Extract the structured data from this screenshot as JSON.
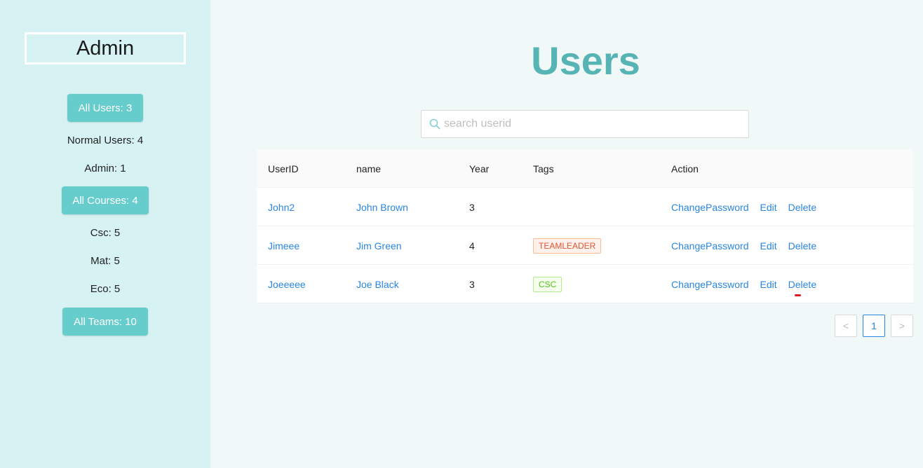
{
  "sidebar": {
    "title": "Admin",
    "all_users": "All Users: 3",
    "normal_users": "Normal Users: 4",
    "admin_count": "Admin: 1",
    "all_courses": "All Courses: 4",
    "csc": "Csc: 5",
    "mat": "Mat: 5",
    "eco": "Eco: 5",
    "all_teams": "All Teams: 10"
  },
  "main": {
    "title": "Users",
    "search_placeholder": "search userid"
  },
  "table": {
    "headers": [
      "UserID",
      "name",
      "Year",
      "Tags",
      "Action"
    ],
    "actions": [
      "ChangePassword",
      "Edit",
      "Delete"
    ],
    "rows": [
      {
        "userid": "John2",
        "name": "John Brown",
        "year": "3",
        "tag": ""
      },
      {
        "userid": "Jimeee",
        "name": "Jim Green",
        "year": "4",
        "tag": "TEAMLEADER"
      },
      {
        "userid": "Joeeeee",
        "name": "Joe Black",
        "year": "3",
        "tag": "CSC"
      }
    ]
  },
  "pagination": {
    "prev": "<",
    "current": "1",
    "next": ">"
  },
  "colors": {
    "accent": "#66cccc",
    "title": "#56b4b4",
    "link": "#2a86e0",
    "tag_teamleader_text": "#e05533",
    "tag_teamleader_bg": "#fff2ec",
    "tag_teamleader_border": "#ffbb96",
    "tag_csc_text": "#52c41a",
    "tag_csc_bg": "#f6ffed",
    "tag_csc_border": "#b7eb8f"
  }
}
